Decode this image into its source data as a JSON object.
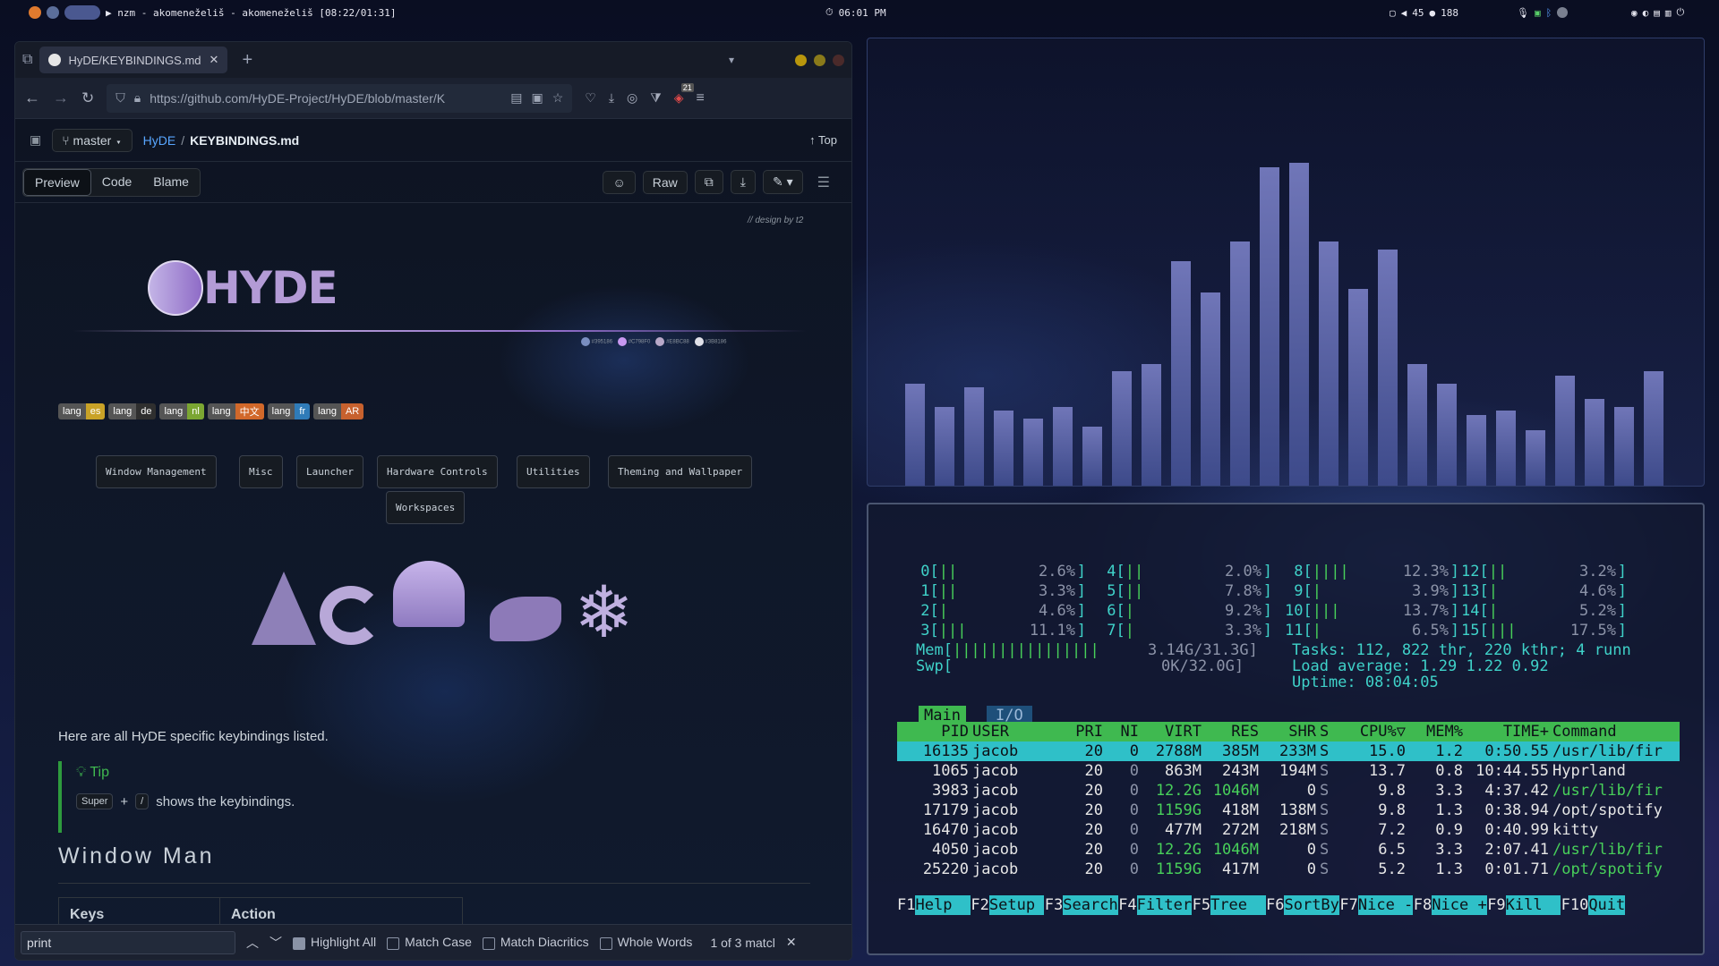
{
  "topbar": {
    "left_title": "▶ nzm - akomeneželiš - akomeneželiš [08:22/01:31]",
    "clock": "06:01 PM",
    "volume": "45",
    "brightness": "188"
  },
  "browser": {
    "tab_title": "HyDE/KEYBINDINGS.md at",
    "url": "https://github.com/HyDE-Project/HyDE/blob/master/K",
    "ext_badge": "21",
    "repo": {
      "branch": "master",
      "repo_name": "HyDE",
      "separator": "/",
      "file_name": "KEYBINDINGS.md",
      "top_label": "Top"
    },
    "view_tabs": [
      "Preview",
      "Code",
      "Blame"
    ],
    "raw_label": "Raw",
    "design_credit": "// design by t2",
    "logo_text": "HYDE",
    "colors": [
      "#3b4a6e",
      "#8f6cc7",
      "#b39bc9",
      "#e8e6ef"
    ],
    "color_labels": [
      "#395186",
      "#C798F0",
      "#E8BC88",
      "#3B8186"
    ],
    "lang_badges": [
      {
        "l": "lang",
        "r": "es",
        "color": "#c9a227"
      },
      {
        "l": "lang",
        "r": "de",
        "color": "#2f2f2f"
      },
      {
        "l": "lang",
        "r": "nl",
        "color": "#7ba632"
      },
      {
        "l": "lang",
        "r": "中文",
        "color": "#d1682a"
      },
      {
        "l": "lang",
        "r": "fr",
        "color": "#2f7bb8"
      },
      {
        "l": "lang",
        "r": "AR",
        "color": "#c7612e"
      }
    ],
    "keybind_sections": [
      "Window Management",
      "Misc",
      "Launcher",
      "Hardware Controls",
      "Utilities",
      "Theming and Wallpaper",
      "Workspaces"
    ],
    "intro_text": "Here are all HyDE specific keybindings listed.",
    "tip_title": "Tip",
    "tip_key1": "Super",
    "tip_plus": "+",
    "tip_key2": "/",
    "tip_text": "shows the keybindings.",
    "section_heading": "Window Man",
    "table_headers": [
      "Keys",
      "Action"
    ],
    "find": {
      "query": "print",
      "highlight_all": "Highlight All",
      "match_case": "Match Case",
      "match_diacritics": "Match Diacritics",
      "whole_words": "Whole Words",
      "result": "1 of 3 matcl"
    }
  },
  "cava": {
    "levels": [
      0.26,
      0.2,
      0.25,
      0.19,
      0.17,
      0.2,
      0.15,
      0.29,
      0.31,
      0.57,
      0.49,
      0.62,
      0.81,
      0.82,
      0.62,
      0.5,
      0.6,
      0.31,
      0.26,
      0.18,
      0.19,
      0.14,
      0.28,
      0.22,
      0.2,
      0.29
    ]
  },
  "htop": {
    "cpus": [
      {
        "id": "0",
        "bars": "||",
        "pct": "2.6%"
      },
      {
        "id": "1",
        "bars": "||",
        "pct": "3.3%"
      },
      {
        "id": "2",
        "bars": "|",
        "pct": "4.6%"
      },
      {
        "id": "3",
        "bars": "|||",
        "pct": "11.1%"
      },
      {
        "id": "4",
        "bars": "||",
        "pct": "2.0%"
      },
      {
        "id": "5",
        "bars": "||",
        "pct": "7.8%"
      },
      {
        "id": "6",
        "bars": "|",
        "pct": "9.2%"
      },
      {
        "id": "7",
        "bars": "|",
        "pct": "3.3%"
      },
      {
        "id": "8",
        "bars": "||||",
        "pct": "12.3%"
      },
      {
        "id": "9",
        "bars": "|",
        "pct": "3.9%"
      },
      {
        "id": "10",
        "bars": "|||",
        "pct": "13.7%"
      },
      {
        "id": "11",
        "bars": "|",
        "pct": "6.5%"
      },
      {
        "id": "12",
        "bars": "||",
        "pct": "3.2%"
      },
      {
        "id": "13",
        "bars": "|",
        "pct": "4.6%"
      },
      {
        "id": "14",
        "bars": "|",
        "pct": "5.2%"
      },
      {
        "id": "15",
        "bars": "|||",
        "pct": "17.5%"
      }
    ],
    "mem_label": "Mem[",
    "mem_bars": "||||||||||||||||",
    "mem_value": "3.14G/31.3G]",
    "swp_label": "Swp[",
    "swp_value": "0K/32.0G]",
    "tasks": "Tasks: 112, 822 thr, 220 kthr; 4 runn",
    "load": "Load average: 1.29 1.22 0.92",
    "uptime": "Uptime: 08:04:05",
    "tabs": [
      "Main",
      "I/O"
    ],
    "headers": [
      "PID",
      "USER",
      "PRI",
      "NI",
      "VIRT",
      "RES",
      "SHR",
      "S",
      "CPU%▽",
      "MEM%",
      "TIME+",
      "Command"
    ],
    "processes": [
      [
        "16135",
        "jacob",
        "20",
        "0",
        "2788M",
        "385M",
        "233M",
        "S",
        "15.0",
        "1.2",
        "0:50.55",
        "/usr/lib/fir"
      ],
      [
        "1065",
        "jacob",
        "20",
        "0",
        "863M",
        "243M",
        "194M",
        "S",
        "13.7",
        "0.8",
        "10:44.55",
        "Hyprland"
      ],
      [
        "3983",
        "jacob",
        "20",
        "0",
        "12.2G",
        "1046M",
        "0",
        "S",
        "9.8",
        "3.3",
        "4:37.42",
        "/usr/lib/fir"
      ],
      [
        "17179",
        "jacob",
        "20",
        "0",
        "1159G",
        "418M",
        "138M",
        "S",
        "9.8",
        "1.3",
        "0:38.94",
        "/opt/spotify"
      ],
      [
        "16470",
        "jacob",
        "20",
        "0",
        "477M",
        "272M",
        "218M",
        "S",
        "7.2",
        "0.9",
        "0:40.99",
        "kitty"
      ],
      [
        "4050",
        "jacob",
        "20",
        "0",
        "12.2G",
        "1046M",
        "0",
        "S",
        "6.5",
        "3.3",
        "2:07.41",
        "/usr/lib/fir"
      ],
      [
        "25220",
        "jacob",
        "20",
        "0",
        "1159G",
        "417M",
        "0",
        "S",
        "5.2",
        "1.3",
        "0:01.71",
        "/opt/spotify"
      ]
    ],
    "fkeys": [
      {
        "k": "F1",
        "l": "Help  "
      },
      {
        "k": "F2",
        "l": "Setup "
      },
      {
        "k": "F3",
        "l": "Search"
      },
      {
        "k": "F4",
        "l": "Filter"
      },
      {
        "k": "F5",
        "l": "Tree  "
      },
      {
        "k": "F6",
        "l": "SortBy"
      },
      {
        "k": "F7",
        "l": "Nice -"
      },
      {
        "k": "F8",
        "l": "Nice +"
      },
      {
        "k": "F9",
        "l": "Kill  "
      },
      {
        "k": "F10",
        "l": "Quit"
      }
    ]
  }
}
